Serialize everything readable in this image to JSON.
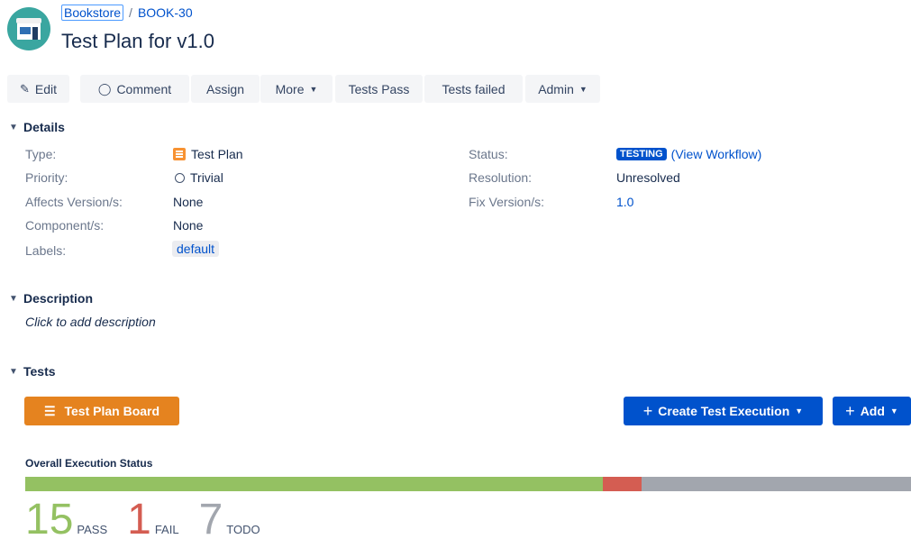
{
  "breadcrumb": {
    "project": "Bookstore",
    "separator": "/",
    "issue_key": "BOOK-30"
  },
  "issue": {
    "title": "Test Plan for v1.0"
  },
  "toolbar": {
    "edit": "Edit",
    "comment": "Comment",
    "assign": "Assign",
    "more": "More",
    "tests_pass": "Tests Pass",
    "tests_failed": "Tests failed",
    "admin": "Admin"
  },
  "sections": {
    "details": "Details",
    "description": "Description",
    "tests": "Tests"
  },
  "details": {
    "left": [
      {
        "label": "Type:",
        "value": "Test Plan"
      },
      {
        "label": "Priority:",
        "value": "Trivial"
      },
      {
        "label": "Affects Version/s:",
        "value": "None"
      },
      {
        "label": "Component/s:",
        "value": "None"
      },
      {
        "label": "Labels:",
        "value": "default"
      }
    ],
    "right": [
      {
        "label": "Status:",
        "value": "TESTING",
        "link": "(View Workflow)"
      },
      {
        "label": "Resolution:",
        "value": "Unresolved"
      },
      {
        "label": "Fix Version/s:",
        "value": "1.0"
      }
    ]
  },
  "description": {
    "placeholder": "Click to add description"
  },
  "tests": {
    "plan_board": "Test Plan Board",
    "create_execution": "Create Test Execution",
    "add": "Add"
  },
  "overall": {
    "title": "Overall Execution Status",
    "pass": {
      "count": "15",
      "label": "PASS",
      "color": "#94c162"
    },
    "fail": {
      "count": "1",
      "label": "FAIL",
      "color": "#d45d52"
    },
    "todo": {
      "count": "7",
      "label": "TODO",
      "color": "#a2a6ae"
    },
    "segments": [
      {
        "name": "pass",
        "fraction": 0.6522
      },
      {
        "name": "fail",
        "fraction": 0.0435
      },
      {
        "name": "todo",
        "fraction": 0.3043
      }
    ]
  }
}
